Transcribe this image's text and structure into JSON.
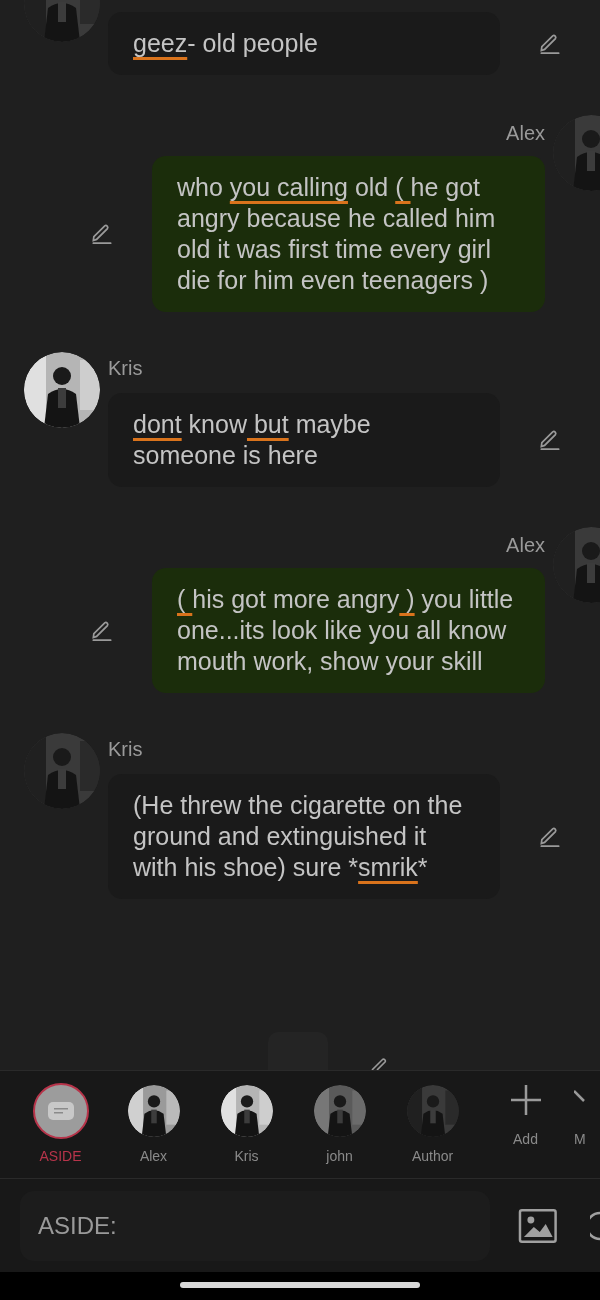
{
  "messages": [
    {
      "kind": "incoming",
      "avatar": {
        "kind": "picture"
      },
      "segments": [
        {
          "text": "geez",
          "flagged": true
        },
        {
          "text": "- old people",
          "flagged": false
        }
      ]
    },
    {
      "kind": "outgoing",
      "sender": "Alex",
      "avatar": {
        "kind": "picture"
      },
      "segments": [
        {
          "text": "who ",
          "flagged": false
        },
        {
          "text": "you calling",
          "flagged": true
        },
        {
          "text": " old ",
          "flagged": false
        },
        {
          "text": "( ",
          "flagged": true
        },
        {
          "text": "he got angry because he called him old it was first time every girl die for him even teenagers )",
          "flagged": false
        }
      ]
    },
    {
      "kind": "incoming",
      "sender": "Kris",
      "avatar": {
        "kind": "picture"
      },
      "segments": [
        {
          "text": "dont",
          "flagged": true
        },
        {
          "text": " know",
          "flagged": false
        },
        {
          "text": " but",
          "flagged": true
        },
        {
          "text": " maybe someone is here",
          "flagged": false
        }
      ]
    },
    {
      "kind": "outgoing",
      "sender": "Alex",
      "avatar": {
        "kind": "picture"
      },
      "segments": [
        {
          "text": "( ",
          "flagged": true
        },
        {
          "text": "his got more angry",
          "flagged": false
        },
        {
          "text": " )",
          "flagged": true
        },
        {
          "text": " you little one...its look like you all know mouth work, show your skill",
          "flagged": false
        }
      ]
    },
    {
      "kind": "incoming",
      "sender": "Kris",
      "avatar": {
        "kind": "picture"
      },
      "segments": [
        {
          "text": "(He threw the cigarette on the ground and extinguished it with his shoe) sure *",
          "flagged": false
        },
        {
          "text": "smrik",
          "flagged": true
        },
        {
          "text": "*",
          "flagged": false
        }
      ]
    }
  ],
  "roster": [
    {
      "label": "ASIDE",
      "kind": "aside",
      "selected": true
    },
    {
      "label": "Alex",
      "kind": "character",
      "selected": false
    },
    {
      "label": "Kris",
      "kind": "character",
      "selected": false
    },
    {
      "label": "john",
      "kind": "character",
      "selected": false
    },
    {
      "label": "Author",
      "kind": "character",
      "selected": false
    }
  ],
  "add_button": {
    "label": "Add"
  },
  "more_button": {
    "label": "M"
  },
  "composer": {
    "placeholder": "ASIDE:"
  }
}
